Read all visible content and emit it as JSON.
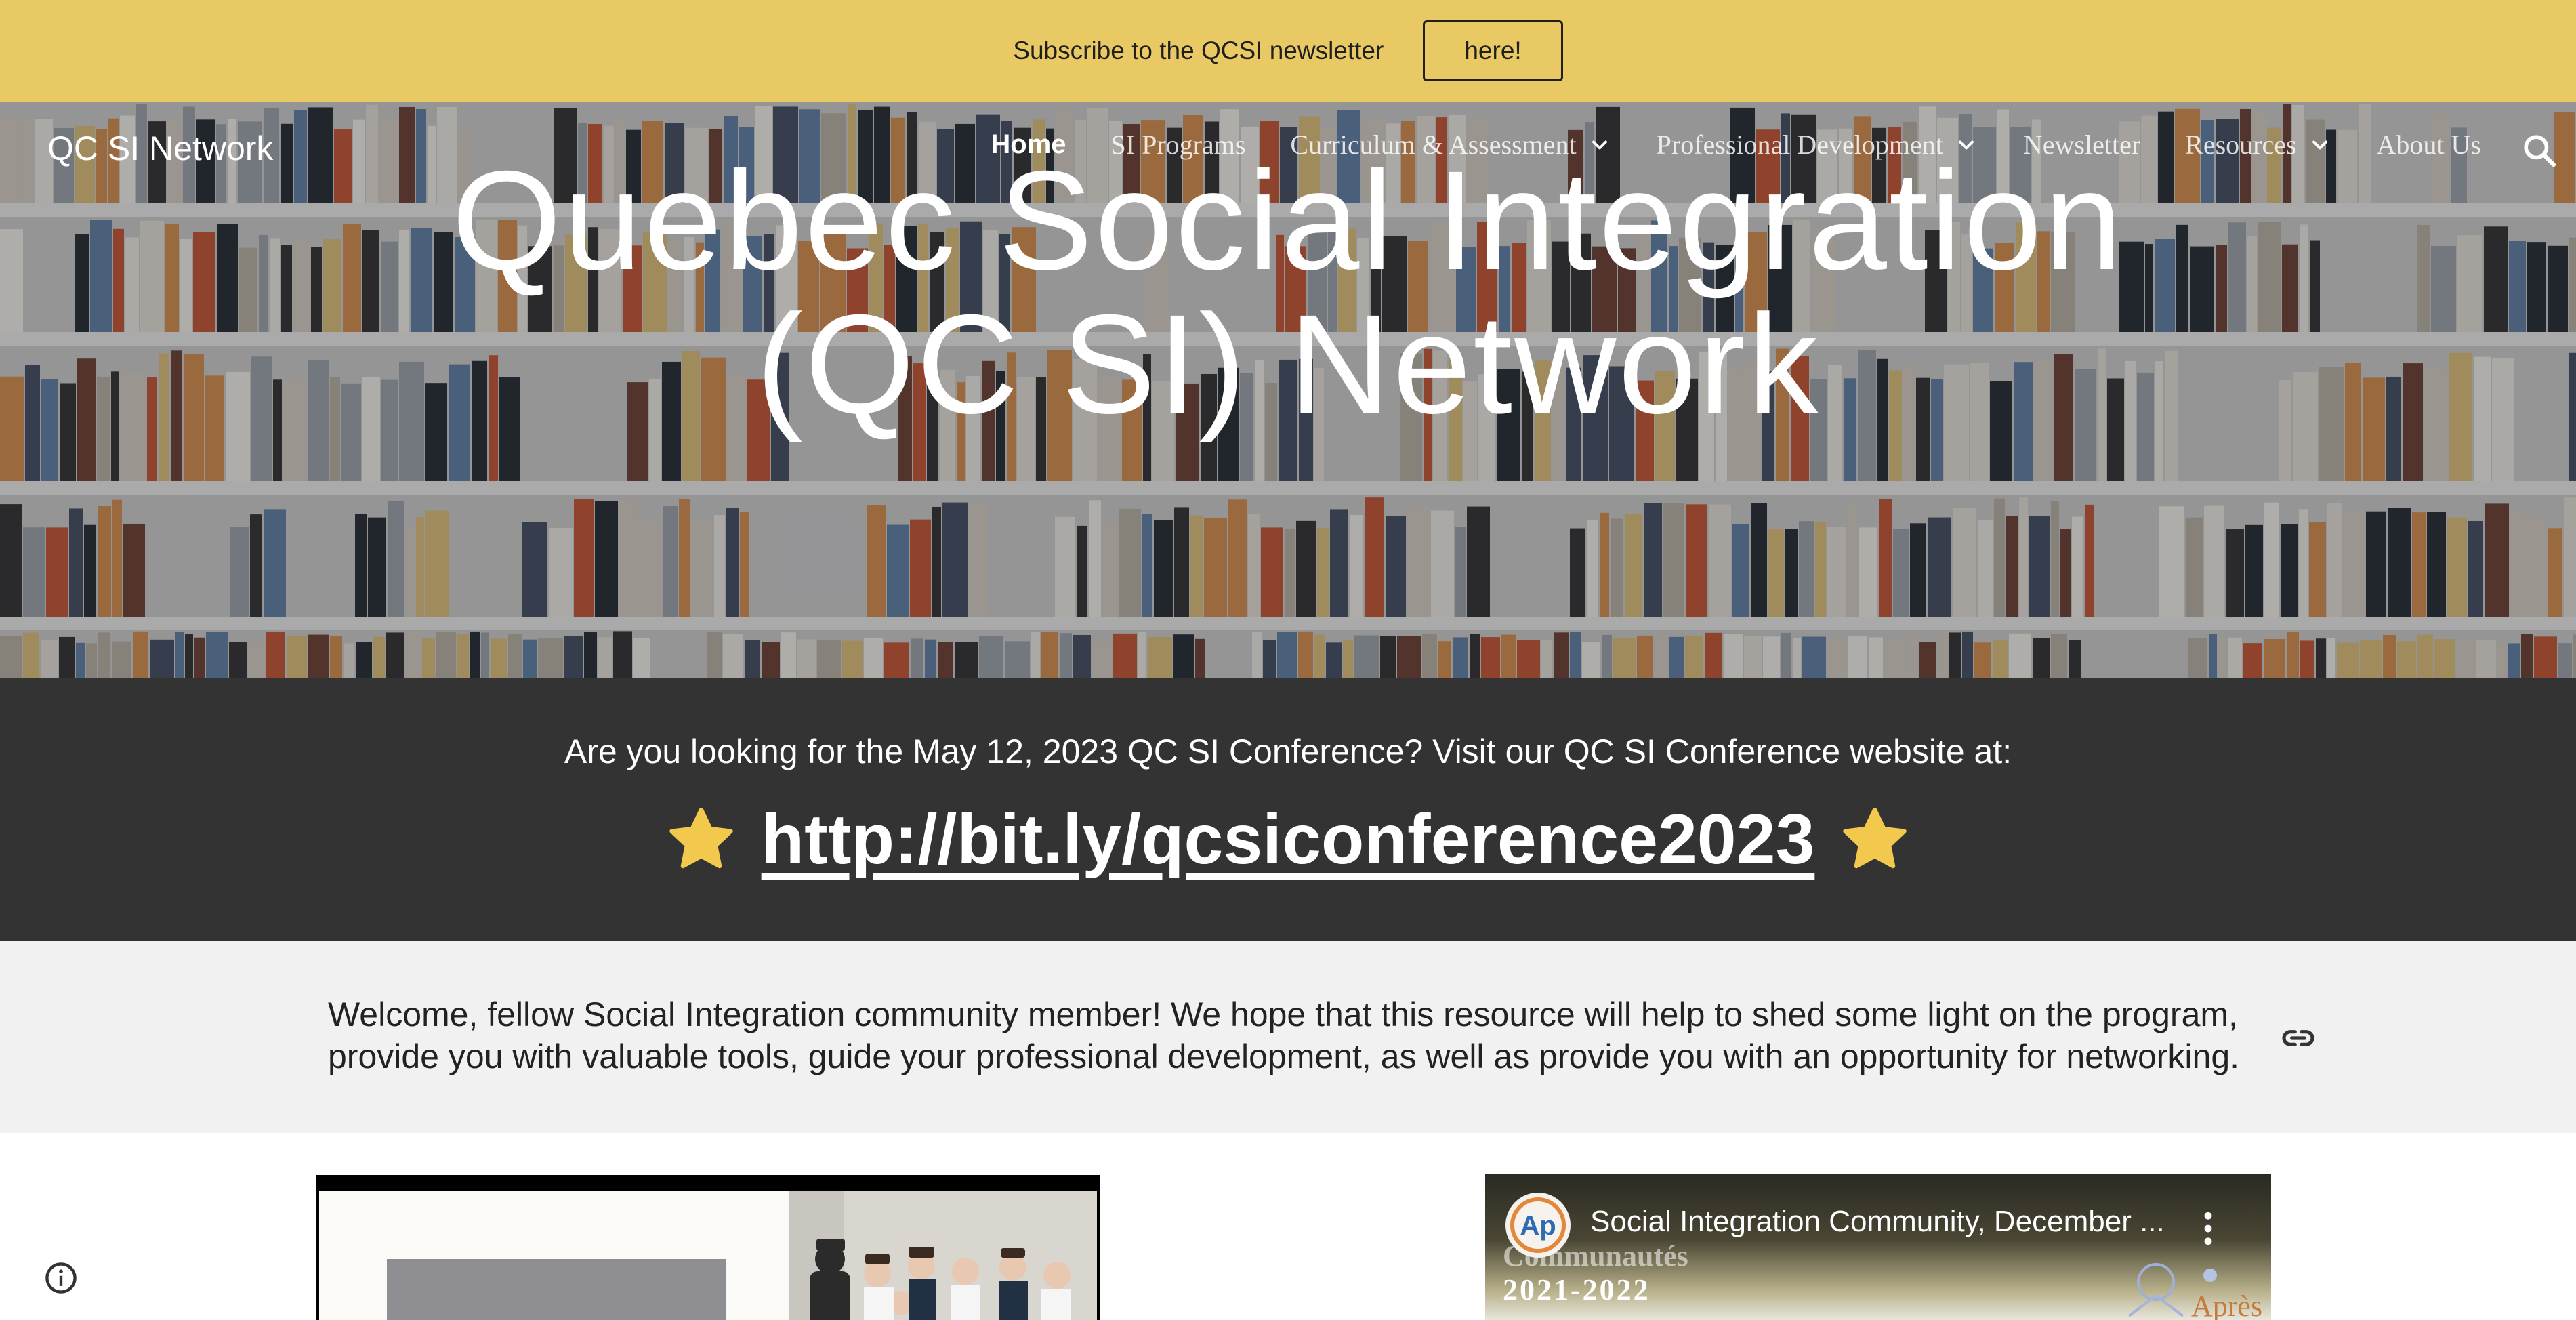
{
  "announcement": {
    "text": "Subscribe to the QCSI newsletter",
    "button_label": "here!"
  },
  "header": {
    "site_title": "QC SI Network",
    "nav": [
      {
        "label": "Home",
        "active": true,
        "has_dropdown": false
      },
      {
        "label": "SI Programs",
        "active": false,
        "has_dropdown": false
      },
      {
        "label": "Curriculum & Assessment",
        "active": false,
        "has_dropdown": true
      },
      {
        "label": "Professional Development",
        "active": false,
        "has_dropdown": true
      },
      {
        "label": "Newsletter",
        "active": false,
        "has_dropdown": false
      },
      {
        "label": "Resources",
        "active": false,
        "has_dropdown": true
      },
      {
        "label": "About Us",
        "active": false,
        "has_dropdown": false
      }
    ],
    "search_icon": "search-icon"
  },
  "hero": {
    "title_line1": "Quebec Social Integration",
    "title_line2": "(QC SI) Network"
  },
  "conference": {
    "text": "Are you looking for the May 12, 2023 QC SI Conference? Visit our QC SI Conference website at:",
    "link": "http://bit.ly/qcsiconference2023",
    "star_icon": "star-icon",
    "star_color": "#f2c94c"
  },
  "welcome": {
    "text": "Welcome, fellow Social Integration community member! We hope that this resource will help to shed some light on the program, provide you with valuable tools, guide your professional development, as well as provide you with an opportunity for networking.",
    "link_icon": "link-icon"
  },
  "video": {
    "title": "Social Integration Community, December ...",
    "channel_logo_text": "Ap",
    "overlay_line1": "Communautés",
    "overlay_line2": "2021-2022",
    "overlay_corner": "Après"
  },
  "colors": {
    "announcement_bg": "#e9c963",
    "banner_bg": "#333333",
    "welcome_bg": "#f1f1f1"
  }
}
